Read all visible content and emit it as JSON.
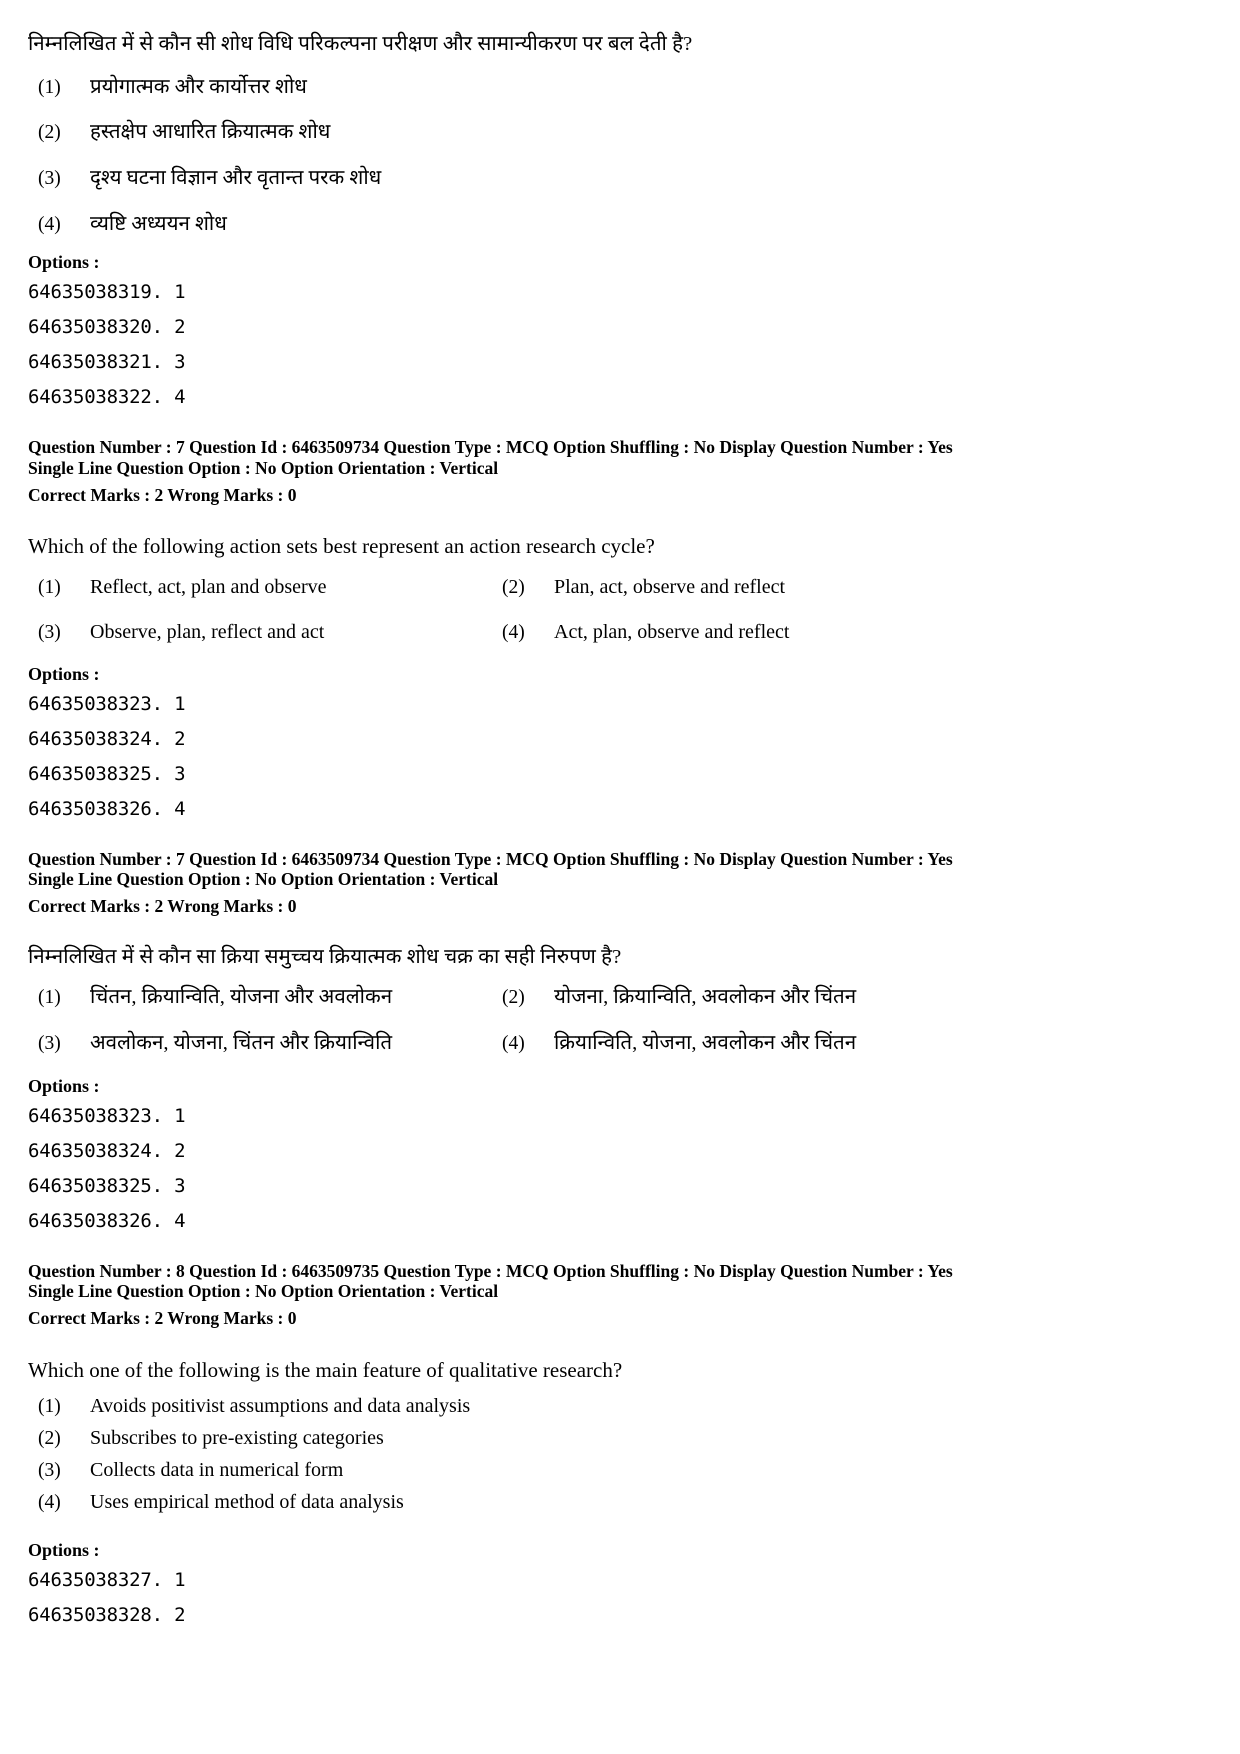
{
  "labels": {
    "options_heading": "Options :"
  },
  "blocks": [
    {
      "id": "q6-hindi-tail",
      "stem": "निम्नलिखित में से कौन सी शोध विधि परिकल्पना परीक्षण और सामान्यीकरण पर बल देती है?",
      "options": [
        {
          "num": "(1)",
          "text": "प्रयोगात्मक और कार्योत्तर शोध"
        },
        {
          "num": "(2)",
          "text": "हस्तक्षेप आधारित क्रियात्मक शोध"
        },
        {
          "num": "(3)",
          "text": "दृश्य घटना विज्ञान और वृतान्त परक शोध"
        },
        {
          "num": "(4)",
          "text": "व्यष्टि अध्ययन शोध"
        }
      ],
      "option_codes": [
        "64635038319. 1",
        "64635038320. 2",
        "64635038321. 3",
        "64635038322. 4"
      ]
    },
    {
      "id": "q7-english",
      "meta_line1": "Question Number : 7  Question Id : 6463509734  Question Type : MCQ  Option Shuffling : No  Display Question Number : Yes",
      "meta_line2": "Single Line Question Option : No  Option Orientation : Vertical",
      "meta_marks": "Correct Marks : 2  Wrong Marks : 0",
      "stem": "Which of the following action sets best represent an action research cycle?",
      "options": [
        {
          "num": "(1)",
          "text": "Reflect, act, plan and observe"
        },
        {
          "num": "(2)",
          "text": "Plan, act, observe and reflect"
        },
        {
          "num": "(3)",
          "text": "Observe, plan, reflect and act"
        },
        {
          "num": "(4)",
          "text": "Act, plan, observe and reflect"
        }
      ],
      "option_codes": [
        "64635038323. 1",
        "64635038324. 2",
        "64635038325. 3",
        "64635038326. 4"
      ]
    },
    {
      "id": "q7-hindi",
      "meta_line1": "Question Number : 7  Question Id : 6463509734  Question Type : MCQ  Option Shuffling : No  Display Question Number : Yes",
      "meta_line2": "Single Line Question Option : No  Option Orientation : Vertical",
      "meta_marks": "Correct Marks : 2  Wrong Marks : 0",
      "stem": "निम्नलिखित में से कौन सा क्रिया समुच्चय क्रियात्मक शोध चक्र का सही निरुपण है?",
      "options": [
        {
          "num": "(1)",
          "text": "चिंतन, क्रियान्विति, योजना और अवलोकन"
        },
        {
          "num": "(2)",
          "text": "योजना, क्रियान्विति, अवलोकन और चिंतन"
        },
        {
          "num": "(3)",
          "text": "अवलोकन, योजना, चिंतन और क्रियान्विति"
        },
        {
          "num": "(4)",
          "text": "क्रियान्विति, योजना, अवलोकन और चिंतन"
        }
      ],
      "option_codes": [
        "64635038323. 1",
        "64635038324. 2",
        "64635038325. 3",
        "64635038326. 4"
      ]
    },
    {
      "id": "q8-english",
      "meta_line1": "Question Number : 8  Question Id : 6463509735  Question Type : MCQ  Option Shuffling : No  Display Question Number : Yes",
      "meta_line2": "Single Line Question Option : No  Option Orientation : Vertical",
      "meta_marks": "Correct Marks : 2  Wrong Marks : 0",
      "stem": "Which one of the following is the main feature of qualitative research?",
      "options": [
        {
          "num": "(1)",
          "text": "Avoids positivist assumptions and data analysis"
        },
        {
          "num": "(2)",
          "text": "Subscribes to pre-existing categories"
        },
        {
          "num": "(3)",
          "text": "Collects data in numerical form"
        },
        {
          "num": "(4)",
          "text": "Uses empirical method of data analysis"
        }
      ],
      "option_codes": [
        "64635038327. 1",
        "64635038328. 2"
      ]
    }
  ]
}
